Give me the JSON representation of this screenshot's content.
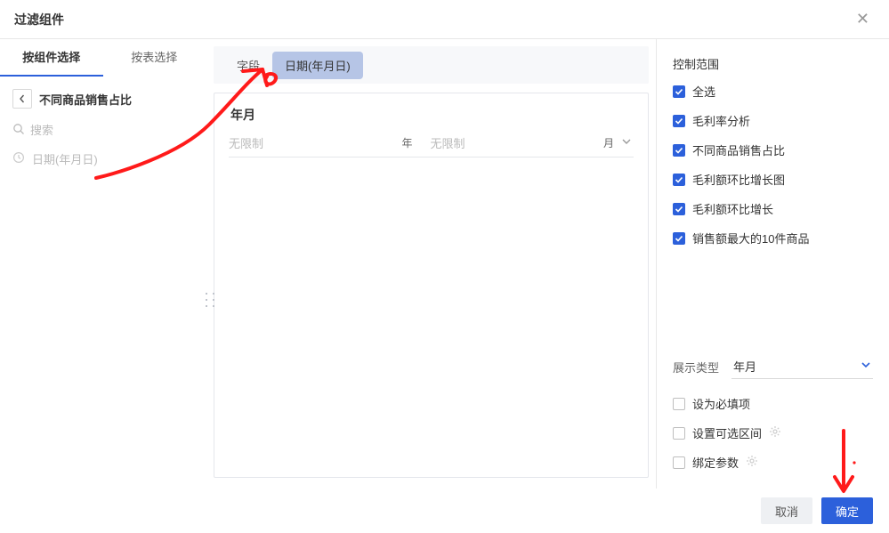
{
  "dialog": {
    "title": "过滤组件",
    "close_aria": "close"
  },
  "left": {
    "tabs": {
      "by_component": "按组件选择",
      "by_table": "按表选择"
    },
    "pane_name": "不同商品销售占比",
    "search_placeholder": "搜索",
    "field": "日期(年月日)"
  },
  "mid": {
    "tabs": {
      "field": "字段",
      "date": "日期(年月日)"
    },
    "ym_title": "年月",
    "year_value": "无限制",
    "year_unit": "年",
    "month_value": "无限制",
    "month_unit": "月"
  },
  "right": {
    "scope_title": "控制范围",
    "items": [
      {
        "label": "全选",
        "checked": true
      },
      {
        "label": "毛利率分析",
        "checked": true
      },
      {
        "label": "不同商品销售占比",
        "checked": true
      },
      {
        "label": "毛利额环比增长图",
        "checked": true
      },
      {
        "label": "毛利额环比增长",
        "checked": true
      },
      {
        "label": "销售额最大的10件商品",
        "checked": true
      }
    ],
    "display_type_label": "展示类型",
    "display_type_value": "年月",
    "options": [
      {
        "label": "设为必填项",
        "checked": false,
        "gear": false
      },
      {
        "label": "设置可选区间",
        "checked": false,
        "gear": true
      },
      {
        "label": "绑定参数",
        "checked": false,
        "gear": true
      }
    ]
  },
  "footer": {
    "cancel": "取消",
    "confirm": "确定"
  },
  "icons": {
    "search": "search-icon",
    "clock": "clock-icon",
    "back": "chevron-left-icon",
    "close": "close-icon",
    "caret": "chevron-down-icon",
    "gear": "gear-icon",
    "check": "check-icon"
  },
  "annotation_color": "#ff1a1a"
}
